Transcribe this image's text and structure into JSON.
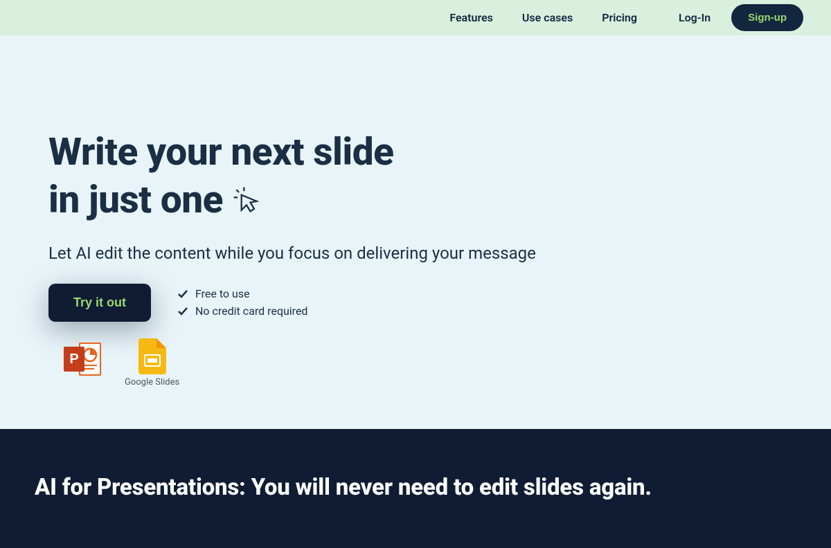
{
  "nav": {
    "features": "Features",
    "usecases": "Use cases",
    "pricing": "Pricing",
    "login": "Log-In",
    "signup": "Sign-up"
  },
  "hero": {
    "title_line1": "Write your next slide",
    "title_line2": "in just one",
    "subtitle": "Let AI edit the content while you focus on delivering your message",
    "cta": "Try it out",
    "benefit1": "Free to use",
    "benefit2": "No credit card required",
    "gslides_label": "Google Slides"
  },
  "dark": {
    "title": "AI for Presentations: You will never need to edit slides again."
  },
  "colors": {
    "header_bg": "#d9f0de",
    "hero_bg": "#e8f4f8",
    "dark_bg": "#0f1c33",
    "accent_green": "#9bd86f",
    "text_dark": "#1a2e44"
  }
}
